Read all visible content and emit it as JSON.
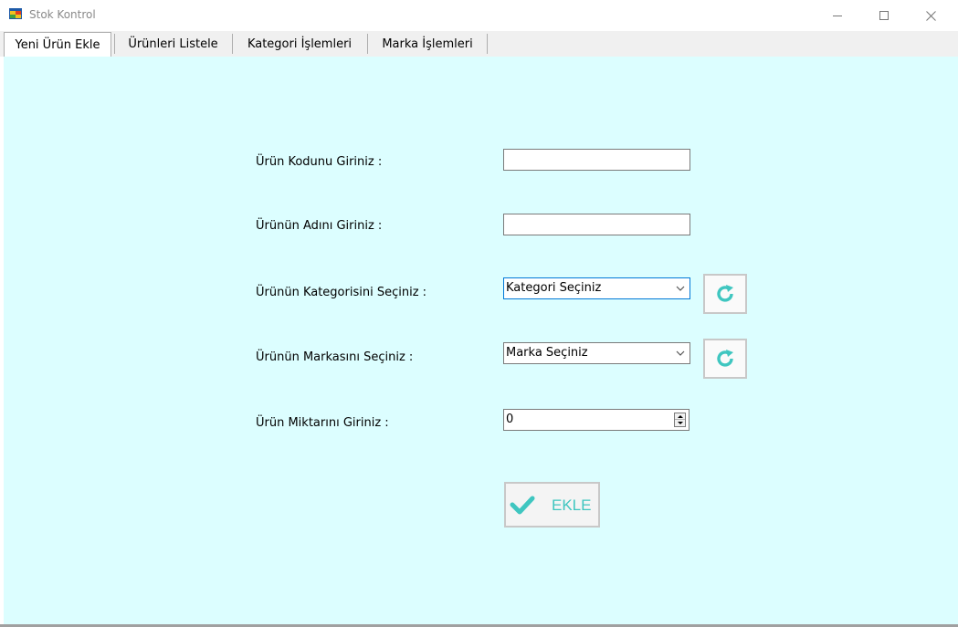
{
  "window": {
    "title": "Stok Kontrol"
  },
  "tabs": [
    {
      "label": "Yeni Ürün Ekle",
      "selected": true
    },
    {
      "label": "Ürünleri Listele",
      "selected": false
    },
    {
      "label": "Kategori İşlemleri",
      "selected": false
    },
    {
      "label": "Marka İşlemleri",
      "selected": false
    }
  ],
  "form": {
    "code_label": "Ürün Kodunu Giriniz :",
    "code_value": "",
    "name_label": "Ürünün Adını Giriniz :",
    "name_value": "",
    "category_label": "Ürünün Kategorisini Seçiniz :",
    "category_selected": "Kategori Seçiniz",
    "brand_label": "Ürünün Markasını Seçiniz :",
    "brand_selected": "Marka Seçiniz",
    "quantity_label": "Ürün Miktarını Giriniz :",
    "quantity_value": "0",
    "submit_label": "EKLE"
  },
  "colors": {
    "page_background": "#dcfeff",
    "accent": "#3fc6c0",
    "focus_border": "#0078d7"
  },
  "icons": {
    "app": "app-window-icon",
    "refresh": "refresh-icon",
    "check": "checkmark-icon"
  }
}
